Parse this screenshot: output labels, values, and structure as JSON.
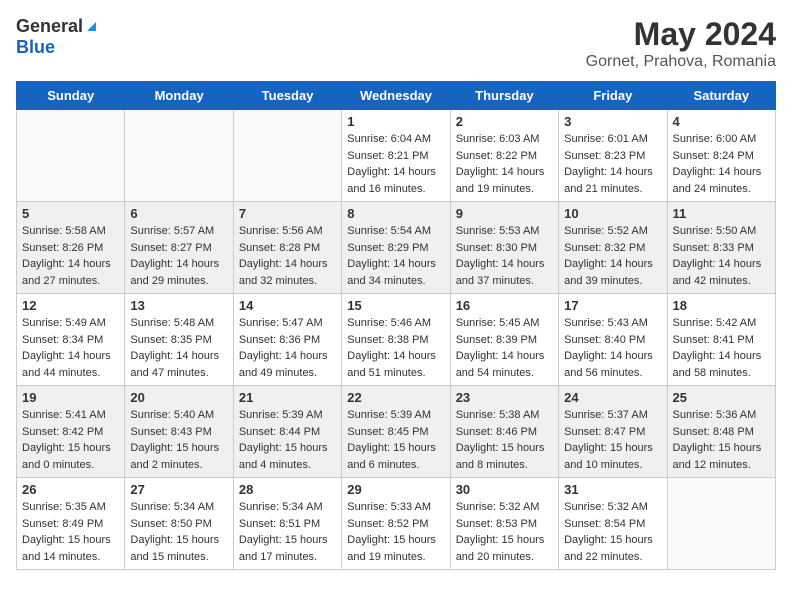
{
  "header": {
    "logo_general": "General",
    "logo_blue": "Blue",
    "title": "May 2024",
    "subtitle": "Gornet, Prahova, Romania"
  },
  "days_of_week": [
    "Sunday",
    "Monday",
    "Tuesday",
    "Wednesday",
    "Thursday",
    "Friday",
    "Saturday"
  ],
  "weeks": [
    [
      {
        "day": "",
        "sunrise": "",
        "sunset": "",
        "daylight": ""
      },
      {
        "day": "",
        "sunrise": "",
        "sunset": "",
        "daylight": ""
      },
      {
        "day": "",
        "sunrise": "",
        "sunset": "",
        "daylight": ""
      },
      {
        "day": "1",
        "sunrise": "Sunrise: 6:04 AM",
        "sunset": "Sunset: 8:21 PM",
        "daylight": "Daylight: 14 hours and 16 minutes."
      },
      {
        "day": "2",
        "sunrise": "Sunrise: 6:03 AM",
        "sunset": "Sunset: 8:22 PM",
        "daylight": "Daylight: 14 hours and 19 minutes."
      },
      {
        "day": "3",
        "sunrise": "Sunrise: 6:01 AM",
        "sunset": "Sunset: 8:23 PM",
        "daylight": "Daylight: 14 hours and 21 minutes."
      },
      {
        "day": "4",
        "sunrise": "Sunrise: 6:00 AM",
        "sunset": "Sunset: 8:24 PM",
        "daylight": "Daylight: 14 hours and 24 minutes."
      }
    ],
    [
      {
        "day": "5",
        "sunrise": "Sunrise: 5:58 AM",
        "sunset": "Sunset: 8:26 PM",
        "daylight": "Daylight: 14 hours and 27 minutes."
      },
      {
        "day": "6",
        "sunrise": "Sunrise: 5:57 AM",
        "sunset": "Sunset: 8:27 PM",
        "daylight": "Daylight: 14 hours and 29 minutes."
      },
      {
        "day": "7",
        "sunrise": "Sunrise: 5:56 AM",
        "sunset": "Sunset: 8:28 PM",
        "daylight": "Daylight: 14 hours and 32 minutes."
      },
      {
        "day": "8",
        "sunrise": "Sunrise: 5:54 AM",
        "sunset": "Sunset: 8:29 PM",
        "daylight": "Daylight: 14 hours and 34 minutes."
      },
      {
        "day": "9",
        "sunrise": "Sunrise: 5:53 AM",
        "sunset": "Sunset: 8:30 PM",
        "daylight": "Daylight: 14 hours and 37 minutes."
      },
      {
        "day": "10",
        "sunrise": "Sunrise: 5:52 AM",
        "sunset": "Sunset: 8:32 PM",
        "daylight": "Daylight: 14 hours and 39 minutes."
      },
      {
        "day": "11",
        "sunrise": "Sunrise: 5:50 AM",
        "sunset": "Sunset: 8:33 PM",
        "daylight": "Daylight: 14 hours and 42 minutes."
      }
    ],
    [
      {
        "day": "12",
        "sunrise": "Sunrise: 5:49 AM",
        "sunset": "Sunset: 8:34 PM",
        "daylight": "Daylight: 14 hours and 44 minutes."
      },
      {
        "day": "13",
        "sunrise": "Sunrise: 5:48 AM",
        "sunset": "Sunset: 8:35 PM",
        "daylight": "Daylight: 14 hours and 47 minutes."
      },
      {
        "day": "14",
        "sunrise": "Sunrise: 5:47 AM",
        "sunset": "Sunset: 8:36 PM",
        "daylight": "Daylight: 14 hours and 49 minutes."
      },
      {
        "day": "15",
        "sunrise": "Sunrise: 5:46 AM",
        "sunset": "Sunset: 8:38 PM",
        "daylight": "Daylight: 14 hours and 51 minutes."
      },
      {
        "day": "16",
        "sunrise": "Sunrise: 5:45 AM",
        "sunset": "Sunset: 8:39 PM",
        "daylight": "Daylight: 14 hours and 54 minutes."
      },
      {
        "day": "17",
        "sunrise": "Sunrise: 5:43 AM",
        "sunset": "Sunset: 8:40 PM",
        "daylight": "Daylight: 14 hours and 56 minutes."
      },
      {
        "day": "18",
        "sunrise": "Sunrise: 5:42 AM",
        "sunset": "Sunset: 8:41 PM",
        "daylight": "Daylight: 14 hours and 58 minutes."
      }
    ],
    [
      {
        "day": "19",
        "sunrise": "Sunrise: 5:41 AM",
        "sunset": "Sunset: 8:42 PM",
        "daylight": "Daylight: 15 hours and 0 minutes."
      },
      {
        "day": "20",
        "sunrise": "Sunrise: 5:40 AM",
        "sunset": "Sunset: 8:43 PM",
        "daylight": "Daylight: 15 hours and 2 minutes."
      },
      {
        "day": "21",
        "sunrise": "Sunrise: 5:39 AM",
        "sunset": "Sunset: 8:44 PM",
        "daylight": "Daylight: 15 hours and 4 minutes."
      },
      {
        "day": "22",
        "sunrise": "Sunrise: 5:39 AM",
        "sunset": "Sunset: 8:45 PM",
        "daylight": "Daylight: 15 hours and 6 minutes."
      },
      {
        "day": "23",
        "sunrise": "Sunrise: 5:38 AM",
        "sunset": "Sunset: 8:46 PM",
        "daylight": "Daylight: 15 hours and 8 minutes."
      },
      {
        "day": "24",
        "sunrise": "Sunrise: 5:37 AM",
        "sunset": "Sunset: 8:47 PM",
        "daylight": "Daylight: 15 hours and 10 minutes."
      },
      {
        "day": "25",
        "sunrise": "Sunrise: 5:36 AM",
        "sunset": "Sunset: 8:48 PM",
        "daylight": "Daylight: 15 hours and 12 minutes."
      }
    ],
    [
      {
        "day": "26",
        "sunrise": "Sunrise: 5:35 AM",
        "sunset": "Sunset: 8:49 PM",
        "daylight": "Daylight: 15 hours and 14 minutes."
      },
      {
        "day": "27",
        "sunrise": "Sunrise: 5:34 AM",
        "sunset": "Sunset: 8:50 PM",
        "daylight": "Daylight: 15 hours and 15 minutes."
      },
      {
        "day": "28",
        "sunrise": "Sunrise: 5:34 AM",
        "sunset": "Sunset: 8:51 PM",
        "daylight": "Daylight: 15 hours and 17 minutes."
      },
      {
        "day": "29",
        "sunrise": "Sunrise: 5:33 AM",
        "sunset": "Sunset: 8:52 PM",
        "daylight": "Daylight: 15 hours and 19 minutes."
      },
      {
        "day": "30",
        "sunrise": "Sunrise: 5:32 AM",
        "sunset": "Sunset: 8:53 PM",
        "daylight": "Daylight: 15 hours and 20 minutes."
      },
      {
        "day": "31",
        "sunrise": "Sunrise: 5:32 AM",
        "sunset": "Sunset: 8:54 PM",
        "daylight": "Daylight: 15 hours and 22 minutes."
      },
      {
        "day": "",
        "sunrise": "",
        "sunset": "",
        "daylight": ""
      }
    ]
  ]
}
